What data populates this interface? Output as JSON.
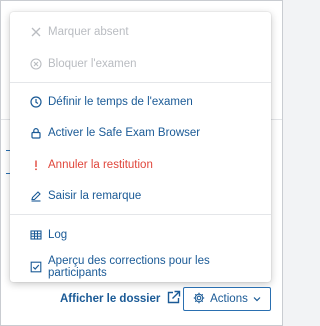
{
  "menu": {
    "items": [
      {
        "label": "Marquer absent",
        "icon": "close-icon",
        "state": "disabled"
      },
      {
        "label": "Bloquer l'examen",
        "icon": "block-icon",
        "state": "disabled"
      },
      {
        "label": "Définir le temps de l'examen",
        "icon": "clock-icon",
        "state": "normal"
      },
      {
        "label": "Activer le Safe Exam Browser",
        "icon": "lock-icon",
        "state": "normal"
      },
      {
        "label": "Annuler la restitution",
        "icon": "exclamation-icon",
        "state": "danger"
      },
      {
        "label": "Saisir la remarque",
        "icon": "pencil-icon",
        "state": "normal"
      },
      {
        "label": "Log",
        "icon": "table-icon",
        "state": "normal"
      },
      {
        "label": "Aperçu des corrections pour les participants",
        "icon": "checkbox-icon",
        "state": "normal"
      }
    ]
  },
  "footer": {
    "view_file_label": "Afficher le dossier",
    "actions_label": "Actions"
  },
  "colors": {
    "link": "#1a5a96",
    "disabled": "#b9bcc1",
    "danger": "#e0463b"
  }
}
